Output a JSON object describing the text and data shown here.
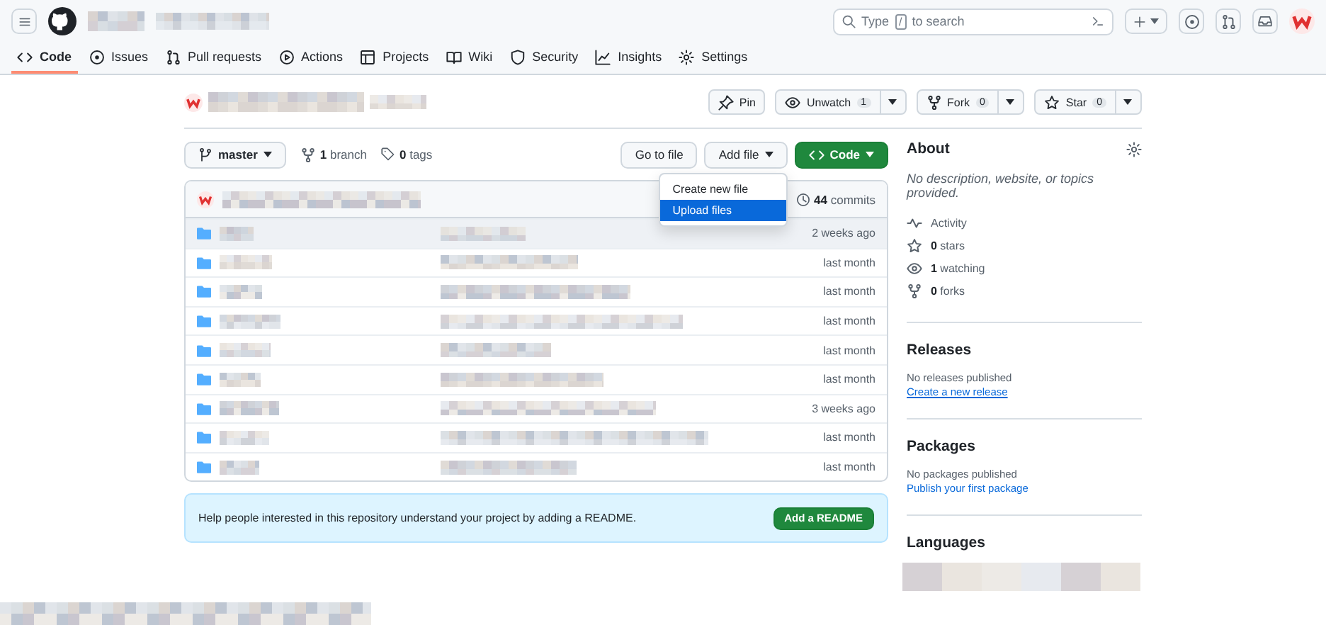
{
  "header": {
    "search": {
      "prefix": "Type",
      "key": "/",
      "suffix": "to search"
    }
  },
  "tabs": [
    {
      "label": "Code",
      "selected": true
    },
    {
      "label": "Issues",
      "selected": false
    },
    {
      "label": "Pull requests",
      "selected": false
    },
    {
      "label": "Actions",
      "selected": false
    },
    {
      "label": "Projects",
      "selected": false
    },
    {
      "label": "Wiki",
      "selected": false
    },
    {
      "label": "Security",
      "selected": false
    },
    {
      "label": "Insights",
      "selected": false
    },
    {
      "label": "Settings",
      "selected": false
    }
  ],
  "repo_actions": [
    {
      "label": "Pin"
    },
    {
      "label": "Unwatch",
      "count": "1"
    },
    {
      "label": "Fork",
      "count": "0"
    },
    {
      "label": "Star",
      "count": "0"
    }
  ],
  "branch": {
    "name": "master",
    "branches": "**1** branch",
    "tags": "**0** tags"
  },
  "buttons": {
    "go_to_file": "Go to file",
    "add_file": "Add file",
    "code": "Code"
  },
  "add_file_menu": [
    {
      "label": "Create new file",
      "selected": false
    },
    {
      "label": "Upload files",
      "selected": true
    }
  ],
  "commits": "**44** commits",
  "files": [
    {
      "time": "2 weeks ago",
      "hovered": true
    },
    {
      "time": "last month",
      "hovered": false
    },
    {
      "time": "last month",
      "hovered": false
    },
    {
      "time": "last month",
      "hovered": false
    },
    {
      "time": "last month",
      "hovered": false
    },
    {
      "time": "last month",
      "hovered": false
    },
    {
      "time": "3 weeks ago",
      "hovered": false
    },
    {
      "time": "last month",
      "hovered": false
    },
    {
      "time": "last month",
      "hovered": false
    }
  ],
  "readme_banner": {
    "text": "Help people interested in this repository understand your project by adding a README.",
    "button": "Add a README"
  },
  "about": {
    "title": "About",
    "description": "No description, website, or topics provided.",
    "stats": [
      "Activity",
      "**0** stars",
      "**1** watching",
      "**0** forks"
    ]
  },
  "releases": {
    "title": "Releases",
    "text": "No releases published",
    "link": "Create a new release"
  },
  "packages": {
    "title": "Packages",
    "text": "No packages published",
    "link": "Publish your first package"
  },
  "languages": {
    "title": "Languages"
  }
}
